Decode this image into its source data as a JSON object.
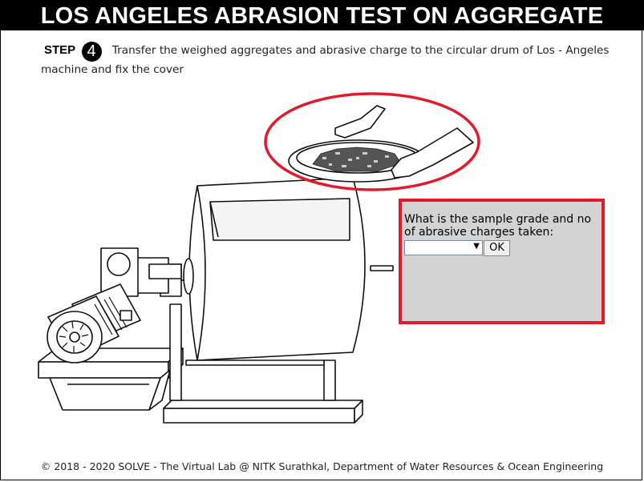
{
  "header": {
    "title": "LOS ANGELES ABRASION TEST ON AGGREGATE"
  },
  "step": {
    "label": "STEP",
    "number": "4",
    "instruction": "Transfer the weighed aggregates and abrasive charge to the circular drum of Los - Angeles machine and fix the cover"
  },
  "question": {
    "prompt": "What is the sample grade and no of abrasive charges taken:",
    "select_value": "",
    "ok_label": "OK"
  },
  "footer": {
    "text": "© 2018 - 2020 SOLVE - The Virtual Lab @ NITK Surathkal, Department of Water Resources & Ocean Engineering"
  },
  "colors": {
    "highlight": "#e11b2a",
    "panel_bg": "#d3d3d3",
    "title_bg": "#000000"
  },
  "illustration": {
    "machine": "los-angeles-abrasion-machine",
    "highlighted_item": "pan-of-aggregates-held-by-hands"
  }
}
